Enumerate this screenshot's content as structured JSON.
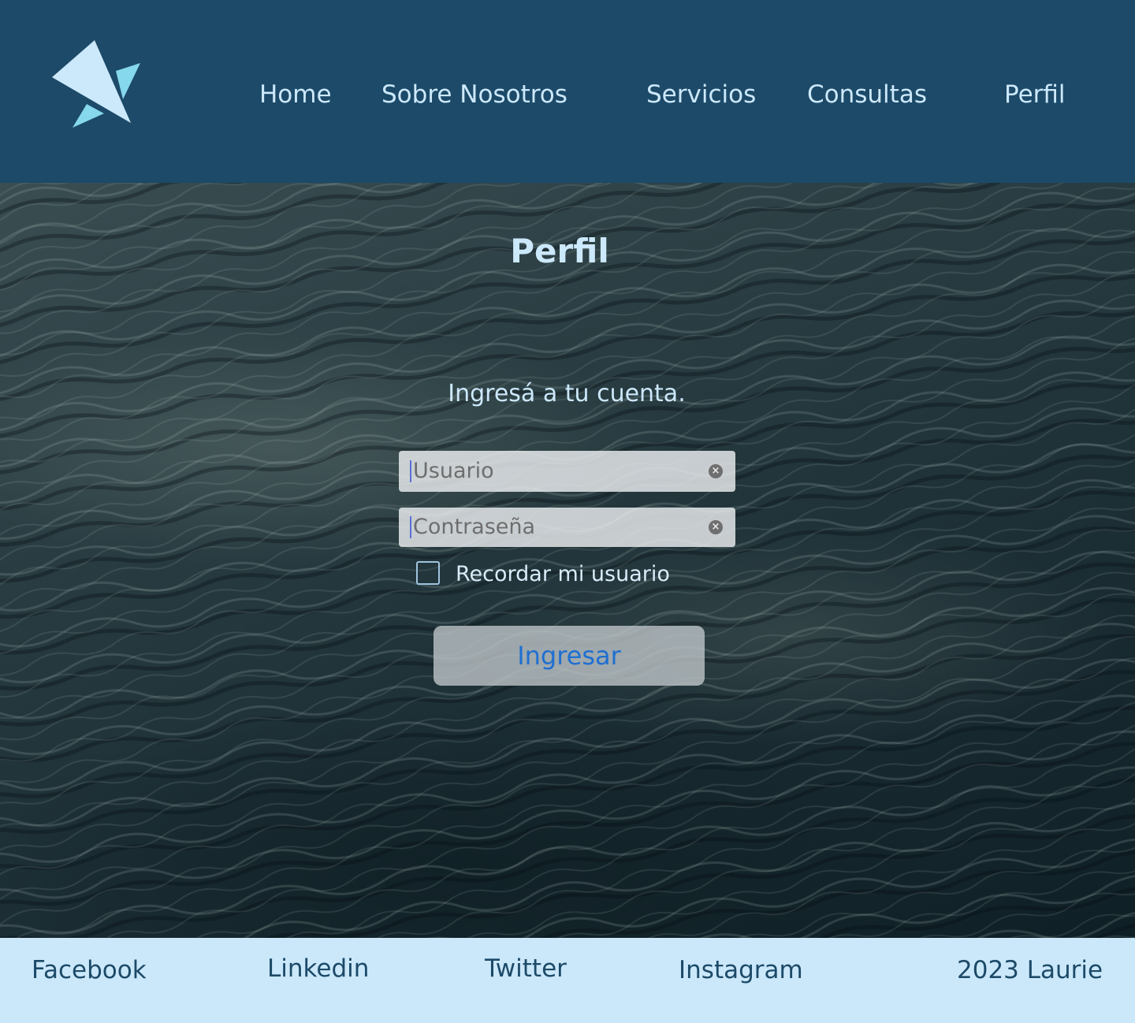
{
  "header": {
    "logo_icon": "star-logo-icon",
    "nav": {
      "home": "Home",
      "about": "Sobre Nosotros",
      "services": "Servicios",
      "queries": "Consultas",
      "profile": "Perfil"
    }
  },
  "main": {
    "title": "Perfil",
    "subtitle": "Ingresá a tu cuenta.",
    "username": {
      "placeholder": "Usuario",
      "value": ""
    },
    "password": {
      "placeholder": "Contraseña",
      "value": ""
    },
    "clear_icon": "clear-icon",
    "remember_label": "Recordar mi usuario",
    "remember_checked": false,
    "submit_label": "Ingresar"
  },
  "footer": {
    "facebook": "Facebook",
    "linkedin": "Linkedin",
    "twitter": "Twitter",
    "instagram": "Instagram",
    "copyright": "2023 Laurie"
  },
  "colors": {
    "header_bg": "#1c4a68",
    "footer_bg": "#cbe8fb",
    "light_text": "#cce8fb",
    "dark_text": "#1c4a68",
    "button_text": "#1f6fd1",
    "logo_primary": "#cce8fb",
    "logo_accent": "#86d8ec"
  }
}
